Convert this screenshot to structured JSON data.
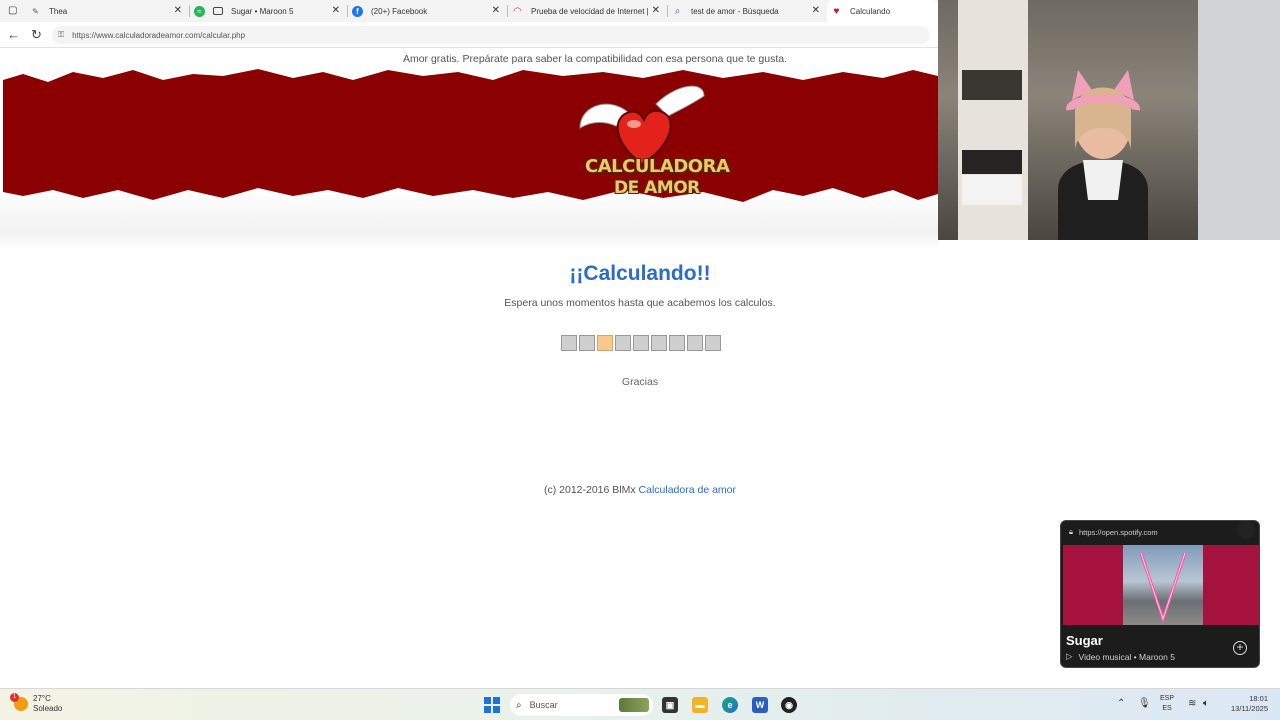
{
  "browser": {
    "tabs": [
      {
        "label": "Thea",
        "icon": "feather-icon",
        "color": "#555555"
      },
      {
        "label": "Sugar • Maroon 5",
        "icon": "spotify-icon",
        "color": "#1db954"
      },
      {
        "label": "(20+) Facebook",
        "icon": "facebook-icon",
        "color": "#1877f2"
      },
      {
        "label": "Prueba de velocidad de Internet |",
        "icon": "speedtest-icon",
        "color": "#c23b3b"
      },
      {
        "label": "test de amor - Búsqueda",
        "icon": "search-icon",
        "color": "#2a6cc8"
      },
      {
        "label": "Calculando",
        "icon": "heart-icon",
        "color": "#c8102e"
      }
    ],
    "url": "https://www.calculadoradeamor.com/calcular.php"
  },
  "page": {
    "tagline": "Amor gratis. Prepárate para saber la compatibilidad con esa persona que te gusta.",
    "logo_line1": "CALCULADORA",
    "logo_line2": "DE AMOR",
    "headline": "¡¡Calculando!!",
    "subtext": "Espera unos momentos hasta que acabemos los calculos.",
    "progress": {
      "total": 9,
      "current": 3
    },
    "thanks": "Gracias",
    "footer_prefix": "(c) 2012-2016 BlMx",
    "footer_link": "Calculadora de amor",
    "banner_color": "#8b0000",
    "link_color": "#2a6cc8"
  },
  "spotify": {
    "url": "https://open.spotify.com",
    "title": "Sugar",
    "subtitle": "Video musical • Maroon 5",
    "accent": "#a4123d"
  },
  "taskbar": {
    "temperature": "27°C",
    "weather": "Soleado",
    "alert_count": "1",
    "search_placeholder": "Buscar",
    "lang_line1": "ESP",
    "lang_line2": "ES",
    "time": "18:01",
    "date": "13/11/2025"
  }
}
